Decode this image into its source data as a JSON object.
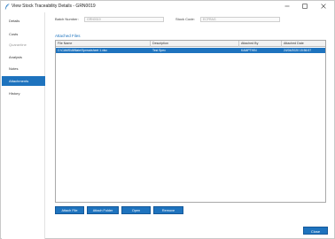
{
  "window": {
    "title": "View Stock Traceability Details - GRN0019",
    "controls": {
      "minimize": "minimize",
      "maximize": "maximize",
      "close": "close"
    }
  },
  "sidebar": {
    "items": [
      {
        "label": "Details",
        "state": "normal"
      },
      {
        "label": "Costs",
        "state": "normal"
      },
      {
        "label": "Quarantine",
        "state": "muted"
      },
      {
        "label": "Analysis",
        "state": "normal"
      },
      {
        "label": "Notes",
        "state": "normal"
      },
      {
        "label": "Attachments",
        "state": "active"
      },
      {
        "label": "History",
        "state": "normal"
      }
    ]
  },
  "fields": {
    "batch_number_label": "Batch Number:",
    "batch_number_value": "GRN0019",
    "stock_code_label": "Stock Code:",
    "stock_code_value": "ECFRAG"
  },
  "attached_files": {
    "title": "Attached Files",
    "columns": [
      "File Name",
      "Description",
      "Attached By",
      "Attached Date"
    ],
    "rows": [
      [
        "C:\\CAMS\\Affiliate\\Spreadsheet 1.xlsx",
        "Test Spec",
        "KAMPTHIN",
        "24/04/2020 15:56:57"
      ]
    ]
  },
  "actions": {
    "attach_file": "Attach File",
    "attach_folder": "Attach Folder",
    "open": "Open",
    "remove": "Remove",
    "close": "Close"
  },
  "colors": {
    "accent": "#1e73be",
    "muted_text": "#9a9a9a"
  }
}
